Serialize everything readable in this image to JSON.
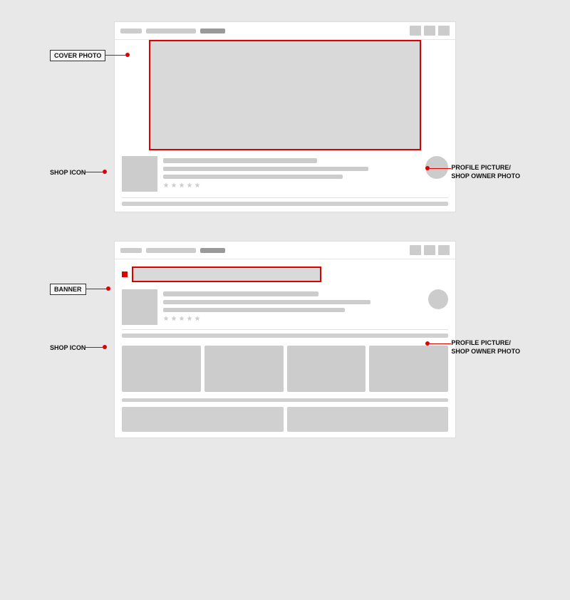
{
  "section1": {
    "label_cover": "COVER PHOTO",
    "label_shop_icon": "SHOP ICON",
    "label_profile": "PROFILE PICTURE/\nSHOP OWNER PHOTO"
  },
  "section2": {
    "label_banner": "BANNER",
    "label_shop_icon": "SHOP ICON",
    "label_profile": "PROFILE PICTURE/\nSHOP OWNER PHOTO"
  },
  "colors": {
    "red": "#dd0000",
    "placeholder": "#cccccc",
    "placeholder_dark": "#bbbbbb",
    "bg": "#d9d9d9"
  }
}
